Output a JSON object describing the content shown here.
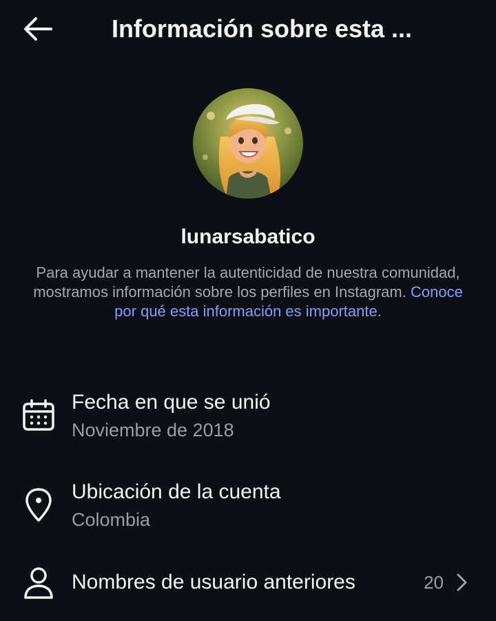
{
  "header": {
    "title": "Información sobre esta ...",
    "back_icon": "back-arrow-icon"
  },
  "profile": {
    "username": "lunarsabatico",
    "avatar_icon": "profile-avatar"
  },
  "intro": {
    "text": "Para ayudar a mantener la autenticidad de nuestra comunidad, mostramos información sobre los perfiles en Instagram. ",
    "link": "Conoce por qué esta información es importante."
  },
  "rows": [
    {
      "icon": "calendar-icon",
      "title": "Fecha en que se unió",
      "subtitle": "Noviembre de 2018"
    },
    {
      "icon": "location-pin-icon",
      "title": "Ubicación de la cuenta",
      "subtitle": "Colombia"
    },
    {
      "icon": "person-icon",
      "title": "Nombres de usuario anteriores",
      "count": "20",
      "chevron": "chevron-right-icon"
    }
  ],
  "colors": {
    "background": "#0c0f14",
    "text_primary": "#f5f5f5",
    "text_secondary": "#9b9ea4",
    "link": "#8a9cfa"
  }
}
